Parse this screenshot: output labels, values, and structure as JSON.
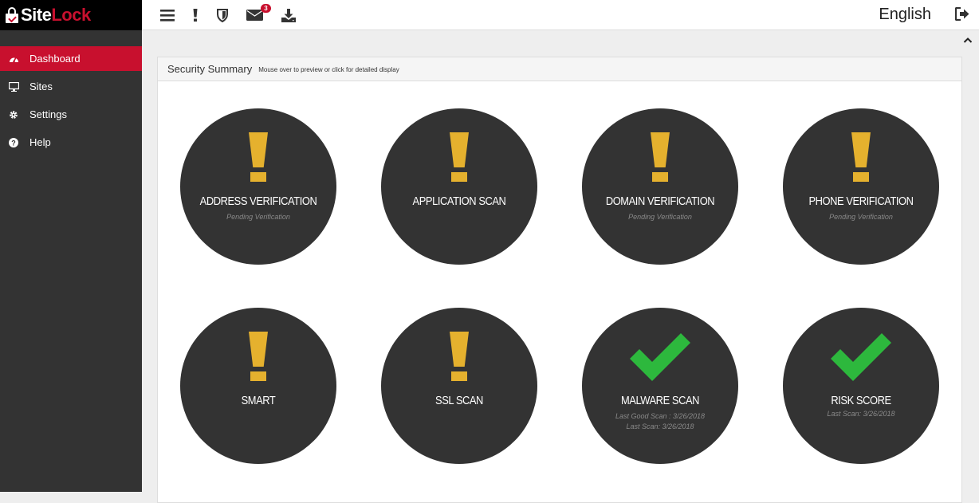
{
  "brand": {
    "site": "Site",
    "lock": "Lock"
  },
  "sidebar": {
    "items": [
      {
        "label": "Dashboard",
        "icon": "dashboard-icon",
        "active": true
      },
      {
        "label": "Sites",
        "icon": "monitor-icon",
        "active": false
      },
      {
        "label": "Settings",
        "icon": "gear-icon",
        "active": false
      },
      {
        "label": "Help",
        "icon": "question-circle-icon",
        "active": false
      }
    ]
  },
  "topbar": {
    "icons": [
      "menu-icon",
      "alert-icon",
      "shield-icon",
      "mail-icon",
      "download-icon"
    ],
    "mail_badge": "3",
    "language": "English",
    "signout_icon": "sign-out-icon"
  },
  "summary": {
    "title": "Security Summary",
    "subtitle": "Mouse over to preview or click for detailed display",
    "tiles": [
      {
        "label": "ADDRESS VERIFICATION",
        "status": "warning",
        "lines": [
          "Pending Verification"
        ]
      },
      {
        "label": "APPLICATION SCAN",
        "status": "warning",
        "lines": []
      },
      {
        "label": "DOMAIN VERIFICATION",
        "status": "warning",
        "lines": [
          "Pending Verification"
        ]
      },
      {
        "label": "PHONE VERIFICATION",
        "status": "warning",
        "lines": [
          "Pending Verification"
        ]
      },
      {
        "label": "SMART",
        "status": "warning",
        "lines": []
      },
      {
        "label": "SSL SCAN",
        "status": "warning",
        "lines": []
      },
      {
        "label": "MALWARE SCAN",
        "status": "ok",
        "lines": [
          "Last Good Scan : 3/26/2018",
          "Last Scan: 3/26/2018"
        ]
      },
      {
        "label": "RISK SCORE",
        "status": "ok",
        "lines": [
          "Last Scan: 3/26/2018"
        ]
      }
    ]
  },
  "colors": {
    "accent": "#c8102e",
    "warning": "#e5b12e",
    "ok": "#2db83d",
    "circle": "#333333",
    "sidebar": "#333333"
  }
}
